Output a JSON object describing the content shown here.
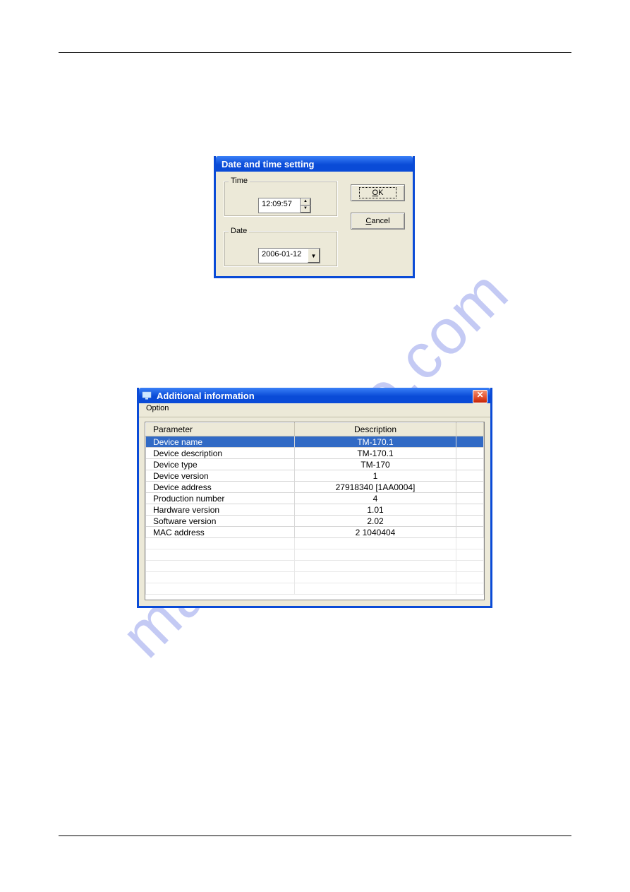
{
  "watermark": "manualshive.com",
  "dialog_datetime": {
    "title": "Date and time setting",
    "group_time_label": "Time",
    "time_value": "12:09:57",
    "group_date_label": "Date",
    "date_value": "2006-01-12",
    "ok_label": "OK",
    "cancel_label": "Cancel"
  },
  "dialog_info": {
    "title": "Additional information",
    "close_label": "X",
    "menu_option": "Option",
    "columns": {
      "param": "Parameter",
      "desc": "Description"
    },
    "rows": [
      {
        "param": "Device name",
        "desc": "TM-170.1"
      },
      {
        "param": "Device description",
        "desc": "TM-170.1"
      },
      {
        "param": "Device type",
        "desc": "TM-170"
      },
      {
        "param": "Device version",
        "desc": "1"
      },
      {
        "param": "Device address",
        "desc": "27918340 [1AA0004]"
      },
      {
        "param": "Production number",
        "desc": "4"
      },
      {
        "param": "Hardware version",
        "desc": "1.01"
      },
      {
        "param": "Software version",
        "desc": "2.02"
      },
      {
        "param": "MAC address",
        "desc": "2 1040404"
      }
    ]
  }
}
